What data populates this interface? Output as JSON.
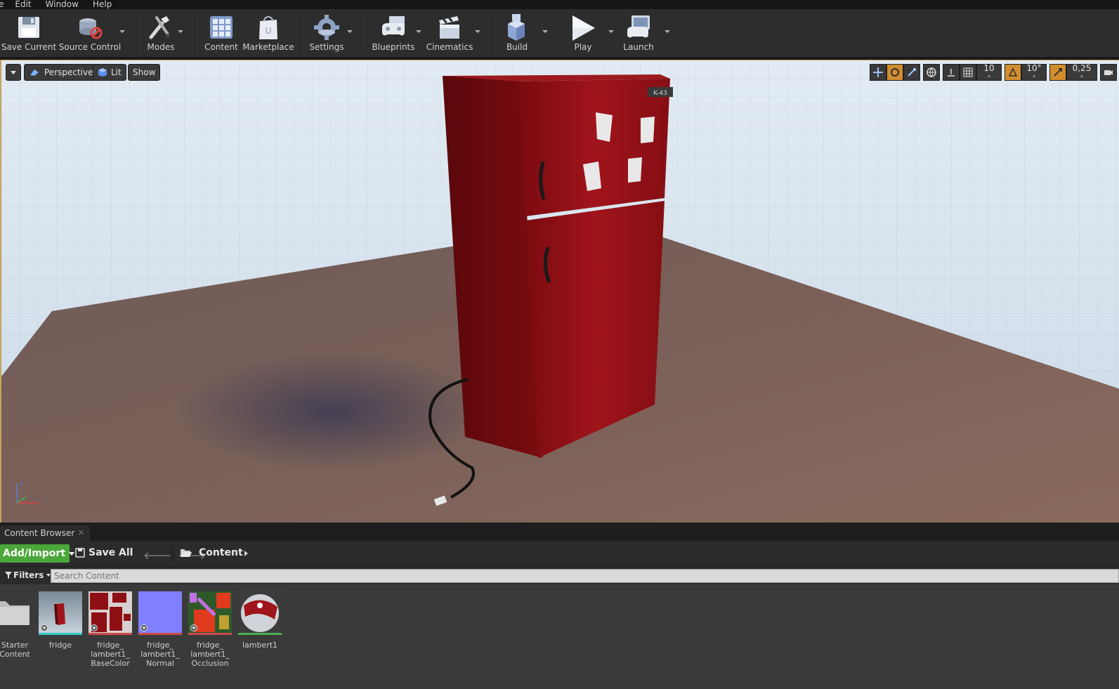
{
  "menu": {
    "items": [
      "e",
      "Edit",
      "Window",
      "Help"
    ]
  },
  "toolbar": {
    "save_current": "Save Current",
    "source_control": "Source Control",
    "modes": "Modes",
    "content": "Content",
    "marketplace": "Marketplace",
    "settings": "Settings",
    "blueprints": "Blueprints",
    "cinematics": "Cinematics",
    "build": "Build",
    "play": "Play",
    "launch": "Launch"
  },
  "viewport": {
    "view_mode": "Perspective",
    "lighting": "Lit",
    "show": "Show",
    "grid_snap": "10",
    "rotation_snap": "10°",
    "scale_snap": "0,25",
    "fridge_label": "K-43"
  },
  "content_browser": {
    "tab_title": "Content Browser",
    "add_import": "Add/Import",
    "save_all": "Save All",
    "breadcrumb": "Content",
    "filters": "Filters",
    "search_placeholder": "Search Content",
    "assets": [
      {
        "label": "Starter Content",
        "type": "folder"
      },
      {
        "label": "fridge",
        "type": "static-mesh",
        "accent": "#35c4c9"
      },
      {
        "label": "fridge_ lambert1_ BaseColor",
        "type": "texture",
        "accent": "#c94b4b"
      },
      {
        "label": "fridge_ lambert1_ Normal",
        "type": "texture",
        "accent": "#c94b4b"
      },
      {
        "label": "fridge_ lambert1_ Occlusion",
        "type": "texture",
        "accent": "#c94b4b"
      },
      {
        "label": "lambert1",
        "type": "material",
        "accent": "#4caf50"
      }
    ]
  },
  "colors": {
    "accent_orange": "#d18d2e",
    "add_import_green": "#4aa73a",
    "fridge_red": "#8e0f14"
  }
}
